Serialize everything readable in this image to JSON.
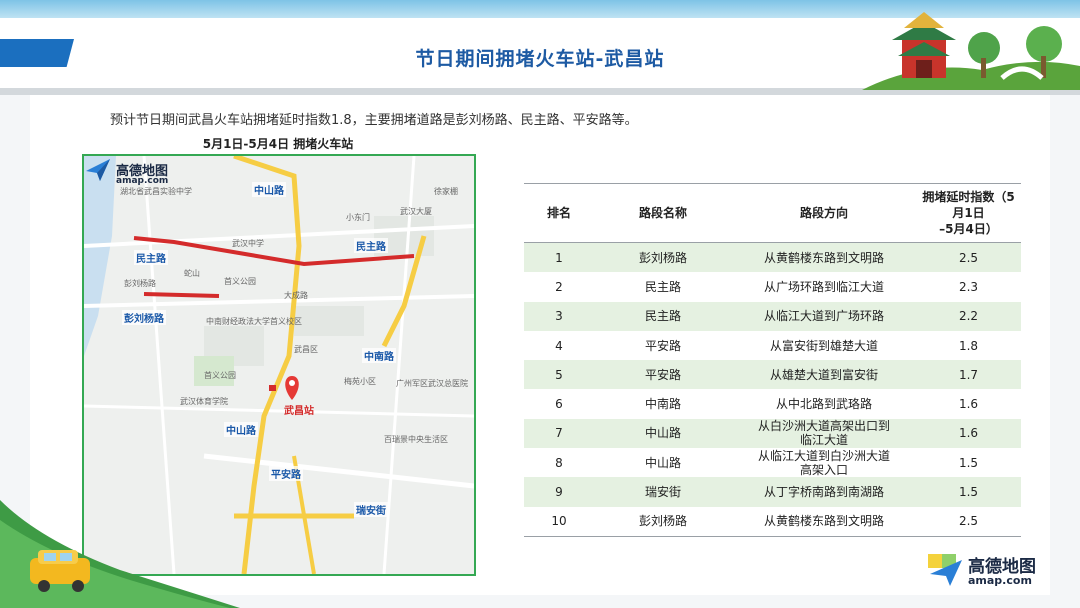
{
  "header": {
    "title": "节日期间拥堵火车站-武昌站"
  },
  "intro": "预计节日期间武昌火车站拥堵延时指数1.8，主要拥堵道路是彭刘杨路、民主路、平安路等。",
  "map": {
    "caption": "5月1日-5月4日 拥堵火车站",
    "logo": {
      "cn": "高德地图",
      "en": "amap.com"
    },
    "station": "武昌站",
    "roads": [
      "中山路",
      "民主路",
      "民主路",
      "彭刘杨路",
      "中南路",
      "中山路",
      "平安路",
      "瑞安街"
    ],
    "places": [
      "湖北省武昌实验中学",
      "武汉中学",
      "蛇山",
      "首义公园",
      "大成路",
      "中南财经政法大学首义校区",
      "首义公园",
      "广州军区武汉总医院",
      "武汉体育学院",
      "梅苑小区",
      "百瑞景中央生活区",
      "武昌区",
      "小东门",
      "武汉大厦",
      "彭刘杨路",
      "徐家棚"
    ]
  },
  "table": {
    "headers": [
      "排名",
      "路段名称",
      "路段方向",
      "拥堵延时指数（5月1日\n–5月4日）"
    ],
    "rows": [
      [
        "1",
        "彭刘杨路",
        "从黄鹤楼东路到文明路",
        "2.5"
      ],
      [
        "2",
        "民主路",
        "从广场环路到临江大道",
        "2.3"
      ],
      [
        "3",
        "民主路",
        "从临江大道到广场环路",
        "2.2"
      ],
      [
        "4",
        "平安路",
        "从富安街到雄楚大道",
        "1.8"
      ],
      [
        "5",
        "平安路",
        "从雄楚大道到富安街",
        "1.7"
      ],
      [
        "6",
        "中南路",
        "从中北路到武珞路",
        "1.6"
      ],
      [
        "7",
        "中山路",
        "从白沙洲大道高架出口到\n临江大道",
        "1.6"
      ],
      [
        "8",
        "中山路",
        "从临江大道到白沙洲大道\n高架入口",
        "1.5"
      ],
      [
        "9",
        "瑞安街",
        "从丁字桥南路到南湖路",
        "1.5"
      ],
      [
        "10",
        "彭刘杨路",
        "从黄鹤楼东路到文明路",
        "2.5"
      ]
    ]
  },
  "brand": {
    "cn": "高德地图",
    "en": "amap.com"
  },
  "colors": {
    "title": "#1d5aa3",
    "congestion": "#d42b2b",
    "row_alt": "#e5f1e1",
    "map_border": "#34a853"
  }
}
